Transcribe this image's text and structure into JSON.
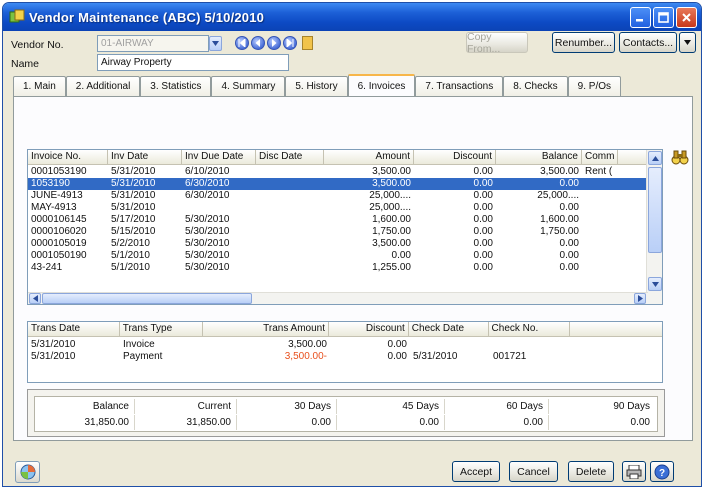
{
  "window": {
    "title": "Vendor Maintenance (ABC) 5/10/2010"
  },
  "vendor": {
    "vendor_no_label": "Vendor No.",
    "vendor_no_value": "01-AIRWAY",
    "name_label": "Name",
    "name_value": "Airway Property"
  },
  "toolbar": {
    "copy_from": "Copy From...",
    "renumber": "Renumber...",
    "contacts": "Contacts..."
  },
  "tabs": [
    {
      "label": "1. Main"
    },
    {
      "label": "2. Additional"
    },
    {
      "label": "3. Statistics"
    },
    {
      "label": "4. Summary"
    },
    {
      "label": "5. History"
    },
    {
      "label": "6. Invoices"
    },
    {
      "label": "7. Transactions"
    },
    {
      "label": "8. Checks"
    },
    {
      "label": "9. P/Os"
    }
  ],
  "active_tab": "6. Invoices",
  "invoices": {
    "columns": [
      "Invoice No.",
      "Inv Date",
      "Inv Due Date",
      "Disc Date",
      "Amount",
      "Discount",
      "Balance",
      "Comm"
    ],
    "selected_index": 1,
    "rows": [
      [
        "0001053190",
        "5/31/2010",
        "6/10/2010",
        "",
        "3,500.00",
        "0.00",
        "3,500.00",
        "Rent ("
      ],
      [
        "1053190",
        "5/31/2010",
        "6/30/2010",
        "",
        "3,500.00",
        "0.00",
        "0.00",
        ""
      ],
      [
        "JUNE-4913",
        "5/31/2010",
        "6/30/2010",
        "",
        "25,000....",
        "0.00",
        "25,000....",
        ""
      ],
      [
        "MAY-4913",
        "5/31/2010",
        "",
        "",
        "25,000....",
        "0.00",
        "0.00",
        ""
      ],
      [
        "0000106145",
        "5/17/2010",
        "5/30/2010",
        "",
        "1,600.00",
        "0.00",
        "1,600.00",
        ""
      ],
      [
        "0000106020",
        "5/15/2010",
        "5/30/2010",
        "",
        "1,750.00",
        "0.00",
        "1,750.00",
        ""
      ],
      [
        "0000105019",
        "5/2/2010",
        "5/30/2010",
        "",
        "3,500.00",
        "0.00",
        "0.00",
        ""
      ],
      [
        "0001050190",
        "5/1/2010",
        "5/30/2010",
        "",
        "0.00",
        "0.00",
        "0.00",
        ""
      ],
      [
        "43-241",
        "5/1/2010",
        "5/30/2010",
        "",
        "1,255.00",
        "0.00",
        "0.00",
        ""
      ]
    ]
  },
  "transactions": {
    "columns": [
      "Trans Date",
      "Trans Type",
      "Trans Amount",
      "Discount",
      "Check Date",
      "Check No."
    ],
    "rows": [
      [
        "5/31/2010",
        "Invoice",
        "3,500.00",
        "0.00",
        "",
        ""
      ],
      [
        "5/31/2010",
        "Payment",
        "3,500.00-",
        "0.00",
        "5/31/2010",
        "001721"
      ]
    ],
    "negative_color": "#e8501e"
  },
  "aging": {
    "headers": [
      "Balance",
      "Current",
      "30 Days",
      "45 Days",
      "60 Days",
      "90 Days"
    ],
    "values": [
      "31,850.00",
      "31,850.00",
      "0.00",
      "0.00",
      "0.00",
      "0.00"
    ]
  },
  "footer": {
    "accept": "Accept",
    "cancel": "Cancel",
    "delete": "Delete"
  },
  "colors": {
    "title_bar": "#0d4ac4",
    "selection": "#316ac5",
    "active_tab_accent": "#f7b64a",
    "window_bg": "#ece9d8"
  },
  "icons": {
    "app": "vendor-app-icon",
    "nav": [
      "first-record-icon",
      "previous-record-icon",
      "next-record-icon",
      "last-record-icon"
    ],
    "memo": "memo-icon",
    "zoom": "binoculars-icon",
    "corner": "data-entry-icon",
    "print": "printer-icon",
    "help": "help-icon"
  }
}
